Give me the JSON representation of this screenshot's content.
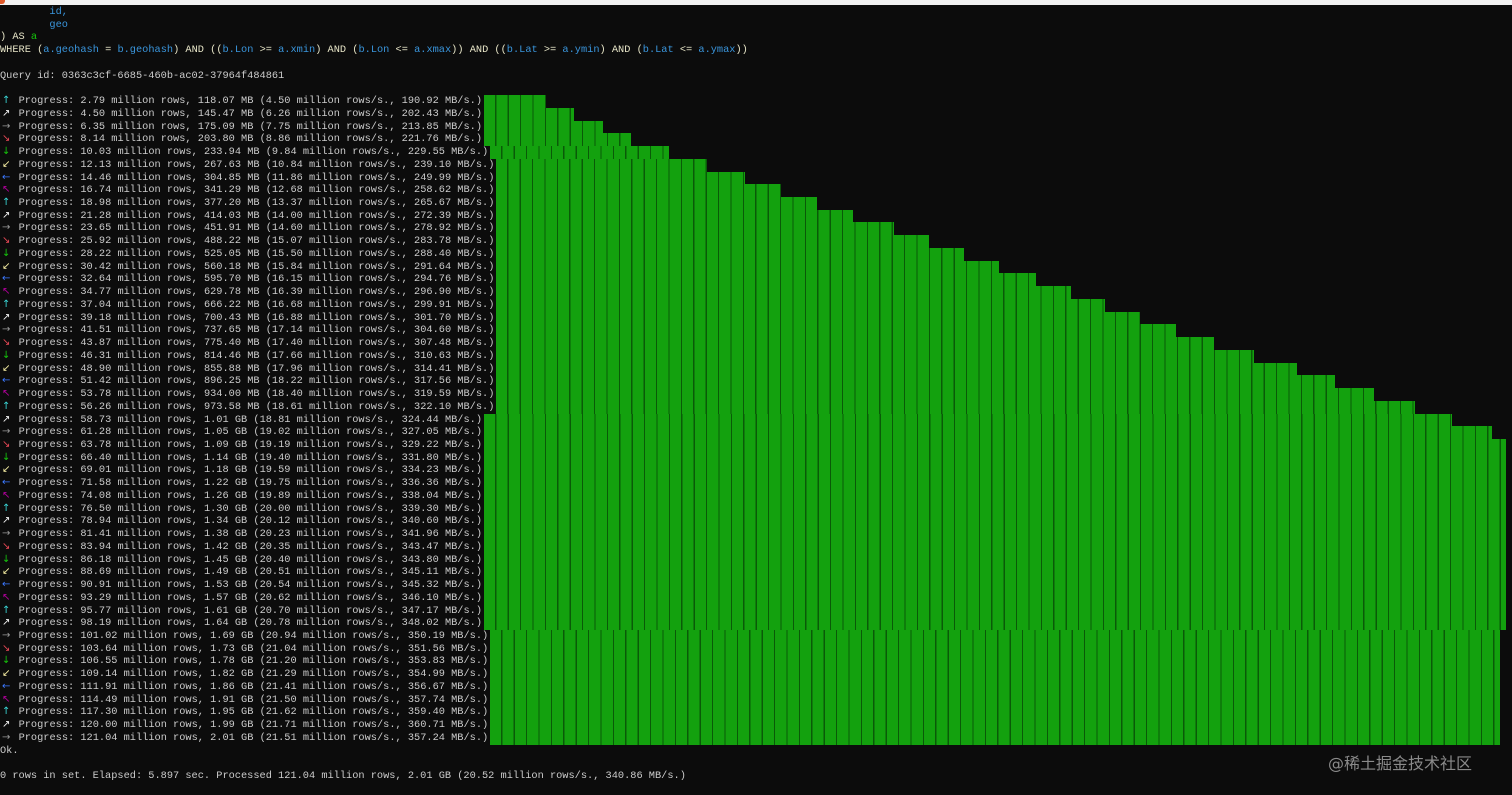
{
  "sql": {
    "line1": "        id,",
    "line2": "        geo",
    "as_line": {
      "prefix": ") AS ",
      "alias": "a"
    },
    "where_segments": [
      {
        "t": "WHERE (",
        "c": "kw"
      },
      {
        "t": "a.geohash",
        "c": "blue"
      },
      {
        "t": " = ",
        "c": "kw"
      },
      {
        "t": "b.geohash",
        "c": "blue"
      },
      {
        "t": ") AND ((",
        "c": "kw"
      },
      {
        "t": "b.Lon",
        "c": "blue"
      },
      {
        "t": " >= ",
        "c": "kw"
      },
      {
        "t": "a.xmin",
        "c": "blue"
      },
      {
        "t": ") AND (",
        "c": "kw"
      },
      {
        "t": "b.Lon",
        "c": "blue"
      },
      {
        "t": " <= ",
        "c": "kw"
      },
      {
        "t": "a.xmax",
        "c": "blue"
      },
      {
        "t": ")) AND ((",
        "c": "kw"
      },
      {
        "t": "b.Lat",
        "c": "blue"
      },
      {
        "t": " >= ",
        "c": "kw"
      },
      {
        "t": "a.ymin",
        "c": "blue"
      },
      {
        "t": ") AND (",
        "c": "kw"
      },
      {
        "t": "b.Lat",
        "c": "blue"
      },
      {
        "t": " <= ",
        "c": "kw"
      },
      {
        "t": "a.ymax",
        "c": "blue"
      },
      {
        "t": "))",
        "c": "kw"
      }
    ]
  },
  "query_id": "Query id: 0363c3cf-6685-460b-ac02-37964f484861",
  "arrows": [
    {
      "glyph": "↑",
      "name": "arrow-up-icon",
      "color": "#3ad6d6"
    },
    {
      "glyph": "↗",
      "name": "arrow-up-right-icon",
      "color": "#f2f2f2"
    },
    {
      "glyph": "→",
      "name": "arrow-right-icon",
      "color": "#9a9a9a"
    },
    {
      "glyph": "↘",
      "name": "arrow-down-right-icon",
      "color": "#e74856"
    },
    {
      "glyph": "↓",
      "name": "arrow-down-icon",
      "color": "#16c60c"
    },
    {
      "glyph": "↙",
      "name": "arrow-down-left-icon",
      "color": "#f9f1a5"
    },
    {
      "glyph": "←",
      "name": "arrow-left-icon",
      "color": "#3b78ff"
    },
    {
      "glyph": "↖",
      "name": "arrow-up-left-icon",
      "color": "#b4009e"
    }
  ],
  "bar_color": "#13a10e",
  "progress": [
    {
      "text": "Progress: 2.79 million rows, 118.07 MB (4.50 million rows/s., 190.92 MB/s.)",
      "bar_fill": 4.6
    },
    {
      "text": "Progress: 4.50 million rows, 145.47 MB (6.26 million rows/s., 202.43 MB/s.)",
      "bar_fill": 7.4
    },
    {
      "text": "Progress: 6.35 million rows, 175.09 MB (7.75 million rows/s., 213.85 MB/s.)",
      "bar_fill": 10.2
    },
    {
      "text": "Progress: 8.14 million rows, 203.80 MB (8.86 million rows/s., 221.76 MB/s.)",
      "bar_fill": 13.0
    },
    {
      "text": "Progress: 10.03 million rows, 233.94 MB (9.84 million rows/s., 229.55 MB/s.)",
      "bar_fill": 16.8
    },
    {
      "text": "Progress: 12.13 million rows, 267.63 MB (10.84 million rows/s., 239.10 MB/s.)",
      "bar_fill": 20.5
    },
    {
      "text": "Progress: 14.46 million rows, 304.85 MB (11.86 million rows/s., 249.99 MB/s.)",
      "bar_fill": 24.3
    },
    {
      "text": "Progress: 16.74 million rows, 341.29 MB (12.68 million rows/s., 258.62 MB/s.)",
      "bar_fill": 27.9
    },
    {
      "text": "Progress: 18.98 million rows, 377.20 MB (13.37 million rows/s., 265.67 MB/s.)",
      "bar_fill": 31.5
    },
    {
      "text": "Progress: 21.28 million rows, 414.03 MB (14.00 million rows/s., 272.39 MB/s.)",
      "bar_fill": 35.1
    },
    {
      "text": "Progress: 23.65 million rows, 451.91 MB (14.60 million rows/s., 278.92 MB/s.)",
      "bar_fill": 39.1
    },
    {
      "text": "Progress: 25.92 million rows, 488.22 MB (15.07 million rows/s., 283.78 MB/s.)",
      "bar_fill": 42.6
    },
    {
      "text": "Progress: 28.22 million rows, 525.05 MB (15.50 million rows/s., 288.40 MB/s.)",
      "bar_fill": 46.1
    },
    {
      "text": "Progress: 30.42 million rows, 560.18 MB (15.84 million rows/s., 291.64 MB/s.)",
      "bar_fill": 49.6
    },
    {
      "text": "Progress: 32.64 million rows, 595.70 MB (16.15 million rows/s., 294.76 MB/s.)",
      "bar_fill": 53.2
    },
    {
      "text": "Progress: 34.77 million rows, 629.78 MB (16.39 million rows/s., 296.90 MB/s.)",
      "bar_fill": 56.7
    },
    {
      "text": "Progress: 37.04 million rows, 666.22 MB (16.68 million rows/s., 299.91 MB/s.)",
      "bar_fill": 60.1
    },
    {
      "text": "Progress: 39.18 million rows, 700.43 MB (16.88 million rows/s., 301.70 MB/s.)",
      "bar_fill": 63.6
    },
    {
      "text": "Progress: 41.51 million rows, 737.65 MB (17.14 million rows/s., 304.60 MB/s.)",
      "bar_fill": 67.2
    },
    {
      "text": "Progress: 43.87 million rows, 775.40 MB (17.40 million rows/s., 307.48 MB/s.)",
      "bar_fill": 70.9
    },
    {
      "text": "Progress: 46.31 million rows, 814.46 MB (17.66 million rows/s., 310.63 MB/s.)",
      "bar_fill": 74.9
    },
    {
      "text": "Progress: 48.90 million rows, 855.88 MB (17.96 million rows/s., 314.41 MB/s.)",
      "bar_fill": 79.2
    },
    {
      "text": "Progress: 51.42 million rows, 896.25 MB (18.22 million rows/s., 317.56 MB/s.)",
      "bar_fill": 83.0
    },
    {
      "text": "Progress: 53.78 million rows, 934.00 MB (18.40 million rows/s., 319.59 MB/s.)",
      "bar_fill": 86.8
    },
    {
      "text": "Progress: 56.26 million rows, 973.58 MB (18.61 million rows/s., 322.10 MB/s.)",
      "bar_fill": 90.9
    },
    {
      "text": "Progress: 58.73 million rows, 1.01 GB (18.81 million rows/s., 324.44 MB/s.)",
      "bar_fill": 94.6
    },
    {
      "text": "Progress: 61.28 million rows, 1.05 GB (19.02 million rows/s., 327.05 MB/s.)",
      "bar_fill": 98.6
    },
    {
      "text": "Progress: 63.78 million rows, 1.09 GB (19.19 million rows/s., 329.22 MB/s.)",
      "bar_fill": 100
    },
    {
      "text": "Progress: 66.40 million rows, 1.14 GB (19.40 million rows/s., 331.80 MB/s.)",
      "bar_fill": 100
    },
    {
      "text": "Progress: 69.01 million rows, 1.18 GB (19.59 million rows/s., 334.23 MB/s.)",
      "bar_fill": 100
    },
    {
      "text": "Progress: 71.58 million rows, 1.22 GB (19.75 million rows/s., 336.36 MB/s.)",
      "bar_fill": 100
    },
    {
      "text": "Progress: 74.08 million rows, 1.26 GB (19.89 million rows/s., 338.04 MB/s.)",
      "bar_fill": 100
    },
    {
      "text": "Progress: 76.50 million rows, 1.30 GB (20.00 million rows/s., 339.30 MB/s.)",
      "bar_fill": 100
    },
    {
      "text": "Progress: 78.94 million rows, 1.34 GB (20.12 million rows/s., 340.60 MB/s.)",
      "bar_fill": 100
    },
    {
      "text": "Progress: 81.41 million rows, 1.38 GB (20.23 million rows/s., 341.96 MB/s.)",
      "bar_fill": 100
    },
    {
      "text": "Progress: 83.94 million rows, 1.42 GB (20.35 million rows/s., 343.47 MB/s.)",
      "bar_fill": 100
    },
    {
      "text": "Progress: 86.18 million rows, 1.45 GB (20.40 million rows/s., 343.80 MB/s.)",
      "bar_fill": 100
    },
    {
      "text": "Progress: 88.69 million rows, 1.49 GB (20.51 million rows/s., 345.11 MB/s.)",
      "bar_fill": 100
    },
    {
      "text": "Progress: 90.91 million rows, 1.53 GB (20.54 million rows/s., 345.32 MB/s.)",
      "bar_fill": 100
    },
    {
      "text": "Progress: 93.29 million rows, 1.57 GB (20.62 million rows/s., 346.10 MB/s.)",
      "bar_fill": 100
    },
    {
      "text": "Progress: 95.77 million rows, 1.61 GB (20.70 million rows/s., 347.17 MB/s.)",
      "bar_fill": 100
    },
    {
      "text": "Progress: 98.19 million rows, 1.64 GB (20.78 million rows/s., 348.02 MB/s.)",
      "bar_fill": 100
    },
    {
      "text": "Progress: 101.02 million rows, 1.69 GB (20.94 million rows/s., 350.19 MB/s.)",
      "bar_fill": 99.4
    },
    {
      "text": "Progress: 103.64 million rows, 1.73 GB (21.04 million rows/s., 351.56 MB/s.)",
      "bar_fill": 99.4
    },
    {
      "text": "Progress: 106.55 million rows, 1.78 GB (21.20 million rows/s., 353.83 MB/s.)",
      "bar_fill": 99.4
    },
    {
      "text": "Progress: 109.14 million rows, 1.82 GB (21.29 million rows/s., 354.99 MB/s.)",
      "bar_fill": 99.4
    },
    {
      "text": "Progress: 111.91 million rows, 1.86 GB (21.41 million rows/s., 356.67 MB/s.)",
      "bar_fill": 99.4
    },
    {
      "text": "Progress: 114.49 million rows, 1.91 GB (21.50 million rows/s., 357.74 MB/s.)",
      "bar_fill": 99.4
    },
    {
      "text": "Progress: 117.30 million rows, 1.95 GB (21.62 million rows/s., 359.40 MB/s.)",
      "bar_fill": 99.4
    },
    {
      "text": "Progress: 120.00 million rows, 1.99 GB (21.71 million rows/s., 360.71 MB/s.)",
      "bar_fill": 99.4
    },
    {
      "text": "Progress: 121.04 million rows, 2.01 GB (21.51 million rows/s., 357.24 MB/s.)",
      "bar_fill": 99.4
    }
  ],
  "ok": "Ok.",
  "summary": "0 rows in set. Elapsed: 5.897 sec. Processed 121.04 million rows, 2.01 GB (20.52 million rows/s., 340.86 MB/s.)",
  "watermark": "@稀土掘金技术社区"
}
